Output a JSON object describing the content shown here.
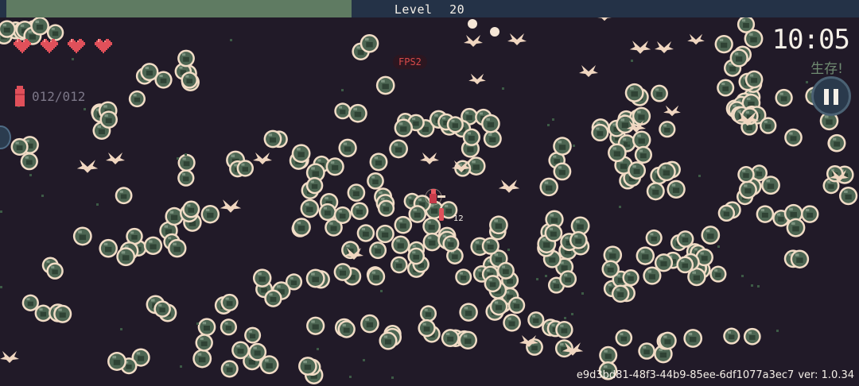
{
  "hud": {
    "level_label": "Level",
    "level_value": "20",
    "xp_progress": 0.405,
    "hearts_count": 4,
    "ammo_text": "012/012",
    "timer": "10:05",
    "survive_label": "生存!",
    "fps_label": "FPS2",
    "build_id": "e9d3bd81-48f3-44b9-85ee-6df1077a3ec7",
    "version_label": "ver: 1.0.34",
    "damage_number": "12"
  },
  "colors": {
    "background": "#211a28",
    "xp_fill": "#5f7b62",
    "xp_track": "#243247",
    "heart": "#e0505a",
    "enemy_body": "#4c6552",
    "enemy_outline": "#f1dcc6",
    "bat": "#f0d6c0",
    "text": "#f5f0e8"
  },
  "icons": {
    "heart": "heart-icon",
    "ammo": "bullet-icon",
    "pause": "pause-icon",
    "enemy": "brain-monster-icon",
    "bat": "bat-icon"
  }
}
